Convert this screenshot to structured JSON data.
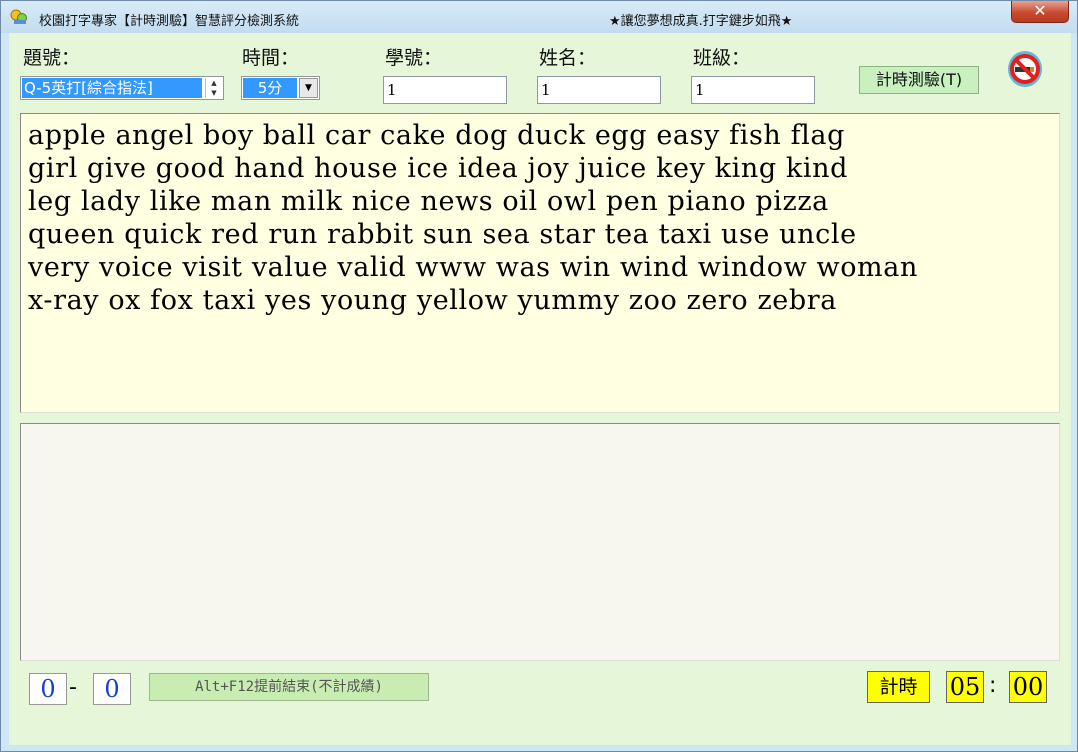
{
  "window": {
    "title": "校園打字專家【計時測驗】智慧評分檢測系統",
    "slogan": "★讓您夢想成真.打字鍵步如飛★",
    "close_glyph": "✕"
  },
  "form": {
    "question_label": "題號：",
    "question_value": "Q-5英打[綜合指法]",
    "time_label": "時間：",
    "time_value": "5分",
    "student_id_label": "學號：",
    "student_id_value": "1",
    "name_label": "姓名：",
    "name_value": "1",
    "class_label": "班級：",
    "class_value": "1",
    "start_button": "計時測驗(T)",
    "no_smoking_icon": "no-smoking-icon"
  },
  "source_text": "apple angel boy ball car cake dog duck egg easy fish flag\ngirl give good hand house ice idea joy juice key king kind\nleg lady like man milk nice news oil owl pen piano pizza\nqueen quick red run rabbit sun sea star tea taxi use uncle\nvery voice visit value valid www was win wind window woman\nx-ray ox fox taxi yes young yellow yummy zoo zero zebra",
  "typing_area": "",
  "status": {
    "typed_count": "0",
    "dash": "-",
    "error_count": "0",
    "end_button": "Alt+F12提前結束(不計成績)",
    "timer_label": "計時",
    "minutes": "05",
    "colon": ":",
    "seconds": "00"
  },
  "colors": {
    "client_bg": "#e6f6d9",
    "source_bg": "#ffffe1",
    "timer_bg": "#ffff00",
    "counter_text": "#1a40c8",
    "selection": "#3399ff"
  }
}
